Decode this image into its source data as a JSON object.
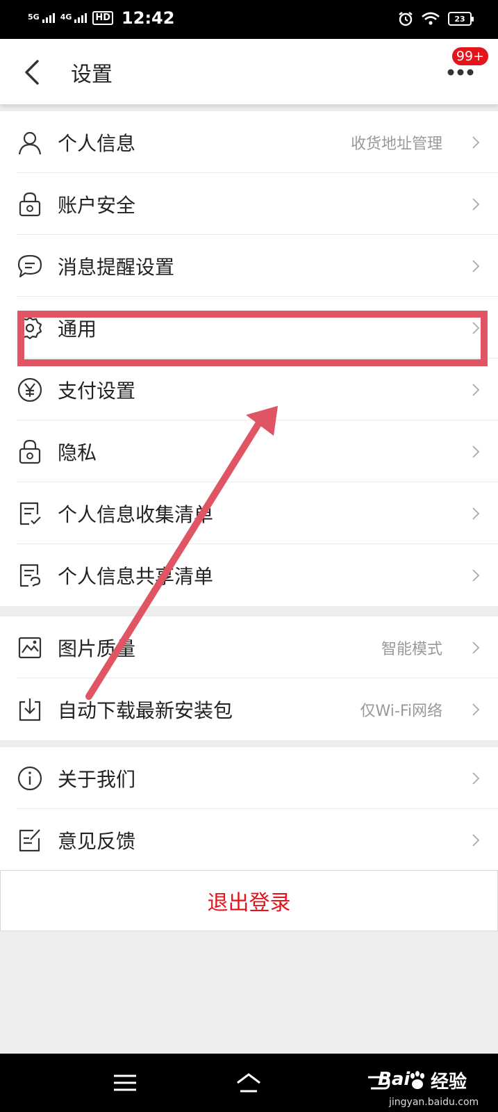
{
  "status_bar": {
    "sim1": "5G",
    "sim2": "4G",
    "hd": "HD",
    "time": "12:42",
    "battery": "23"
  },
  "header": {
    "title": "设置",
    "badge": "99+"
  },
  "sections": [
    {
      "items": [
        {
          "label": "个人信息",
          "value": "收货地址管理",
          "icon": "person-icon"
        },
        {
          "label": "账户安全",
          "value": "",
          "icon": "lock-icon"
        },
        {
          "label": "消息提醒设置",
          "value": "",
          "icon": "chat-bubble-icon"
        },
        {
          "label": "通用",
          "value": "",
          "icon": "gear-icon"
        },
        {
          "label": "支付设置",
          "value": "",
          "icon": "yen-icon"
        },
        {
          "label": "隐私",
          "value": "",
          "icon": "lock-icon"
        },
        {
          "label": "个人信息收集清单",
          "value": "",
          "icon": "checklist-icon"
        },
        {
          "label": "个人信息共享清单",
          "value": "",
          "icon": "share-list-icon"
        }
      ]
    },
    {
      "items": [
        {
          "label": "图片质量",
          "value": "智能模式",
          "icon": "image-icon"
        },
        {
          "label": "自动下载最新安装包",
          "value": "仅Wi-Fi网络",
          "icon": "download-icon"
        }
      ]
    },
    {
      "items": [
        {
          "label": "关于我们",
          "value": "",
          "icon": "info-icon"
        },
        {
          "label": "意见反馈",
          "value": "",
          "icon": "feedback-icon"
        }
      ]
    }
  ],
  "logout": {
    "label": "退出登录"
  },
  "watermark": {
    "brand": "Bai",
    "suffix": "经验",
    "url": "jingyan.baidu.com"
  },
  "colors": {
    "accent": "#e5141c",
    "annotation": "#e05563"
  }
}
